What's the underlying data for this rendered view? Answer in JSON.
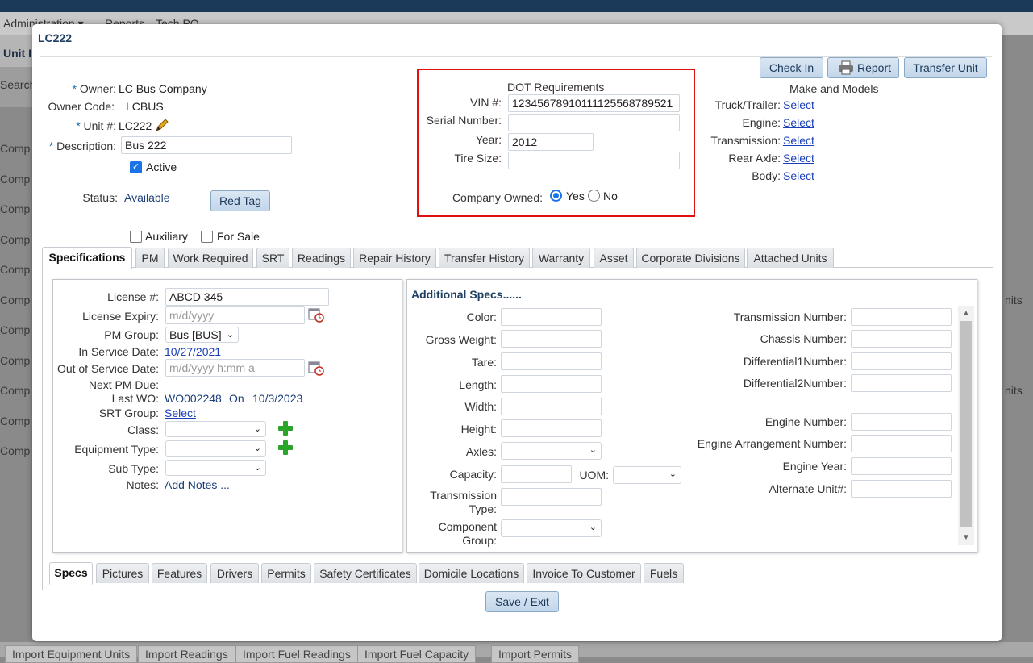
{
  "background": {
    "menu": [
      "Administration ▾",
      "Reports",
      "Tech PO"
    ],
    "page_title": "Unit I",
    "search_label": "Search",
    "rows_left": [
      "Comp",
      "Comp",
      "Comp",
      "Comp",
      "Comp",
      "Comp",
      "Comp",
      "Comp",
      "Comp",
      "Comp",
      "Comp"
    ],
    "right_fragments": [
      "nits",
      "nits"
    ],
    "bottom_tabs": [
      "Import Equipment Units",
      "Import Readings",
      "Import Fuel Readings",
      "Import Fuel Capacity",
      "Import Permits"
    ]
  },
  "modal": {
    "title": "LC222",
    "buttons": {
      "check_in": "Check In",
      "report": "Report",
      "transfer_unit": "Transfer Unit",
      "red_tag": "Red Tag",
      "save_exit": "Save / Exit"
    },
    "owner": {
      "label": "Owner:",
      "value": "LC Bus Company"
    },
    "owner_code": {
      "label": "Owner Code:",
      "value": "LCBUS"
    },
    "unit": {
      "label": "Unit #:",
      "value": "LC222"
    },
    "description": {
      "label": "Description:",
      "value": "Bus 222"
    },
    "active": {
      "label": "Active",
      "checked": true
    },
    "status": {
      "label": "Status:",
      "value": "Available"
    },
    "auxiliary": {
      "label": "Auxiliary",
      "checked": false
    },
    "for_sale": {
      "label": "For Sale",
      "checked": false
    },
    "dot": {
      "heading": "DOT Requirements",
      "vin": {
        "label": "VIN #:",
        "value": "12345678910111125568789521"
      },
      "serial": {
        "label": "Serial Number:",
        "value": ""
      },
      "year": {
        "label": "Year:",
        "value": "2012"
      },
      "tire": {
        "label": "Tire Size:",
        "value": ""
      },
      "company_owned": {
        "label": "Company Owned:",
        "yes": "Yes",
        "no": "No",
        "selected": "Yes"
      }
    },
    "make_models": {
      "heading": "Make and Models",
      "rows": [
        {
          "label": "Truck/Trailer:",
          "link": "Select"
        },
        {
          "label": "Engine:",
          "link": "Select"
        },
        {
          "label": "Transmission:",
          "link": "Select"
        },
        {
          "label": "Rear Axle:",
          "link": "Select"
        },
        {
          "label": "Body:",
          "link": "Select"
        }
      ]
    },
    "tabs": [
      "Specifications",
      "PM",
      "Work Required",
      "SRT",
      "Readings",
      "Repair History",
      "Transfer History",
      "Warranty",
      "Asset",
      "Corporate Divisions",
      "Attached Units"
    ],
    "spec": {
      "license": {
        "label": "License #:",
        "value": "ABCD 345"
      },
      "license_expiry": {
        "label": "License Expiry:",
        "placeholder": "m/d/yyyy"
      },
      "pm_group": {
        "label": "PM Group:",
        "value": "Bus [BUS]"
      },
      "in_service": {
        "label": "In Service Date:",
        "value": "10/27/2021"
      },
      "out_service": {
        "label": "Out of Service Date:",
        "placeholder": "m/d/yyyy h:mm a"
      },
      "next_pm": {
        "label": "Next PM Due:"
      },
      "last_wo": {
        "label": "Last WO:",
        "value": "WO002248",
        "on": "On",
        "date": "10/3/2023"
      },
      "srt_group": {
        "label": "SRT Group:",
        "link": "Select"
      },
      "class": {
        "label": "Class:"
      },
      "equipment_type": {
        "label": "Equipment Type:"
      },
      "sub_type": {
        "label": "Sub Type:"
      },
      "notes": {
        "label": "Notes:",
        "link": "Add Notes ..."
      }
    },
    "additional": {
      "heading": "Additional Specs......",
      "left": [
        "Color:",
        "Gross Weight:",
        "Tare:",
        "Length:",
        "Width:",
        "Height:",
        "Axles:",
        "Capacity:",
        "Transmission Type:",
        "Component Group:"
      ],
      "uom": "UOM:",
      "right": [
        "Transmission Number:",
        "Chassis Number:",
        "Differential1Number:",
        "Differential2Number:",
        "Engine Number:",
        "Engine Arrangement Number:",
        "Engine Year:",
        "Alternate Unit#:"
      ]
    },
    "bottom_tabs": [
      "Specs",
      "Pictures",
      "Features",
      "Drivers",
      "Permits",
      "Safety Certificates",
      "Domicile Locations",
      "Invoice To Customer",
      "Fuels"
    ]
  }
}
